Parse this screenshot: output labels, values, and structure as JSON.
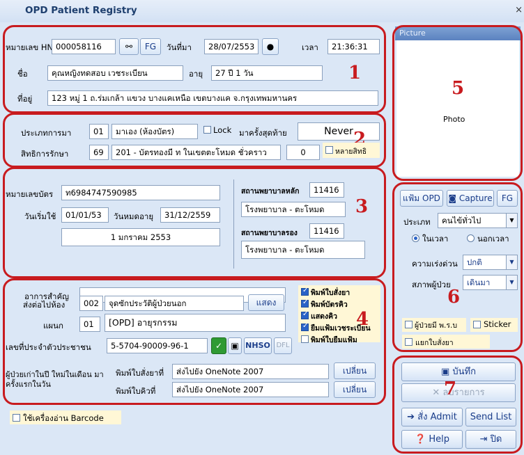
{
  "window": {
    "title": "OPD Patient Registry",
    "close": "×"
  },
  "sec1": {
    "hn_label": "หมายเลข HN",
    "hn_value": "000058116",
    "fg_label": "FG",
    "date_label": "วันที่มา",
    "date_value": "28/07/2553",
    "time_label": "เวลา",
    "time_value": "21:36:31",
    "name_label": "ชื่อ",
    "name_value": "คุณหญิงทดสอบ เวชระเบียน",
    "age_label": "อายุ",
    "age_value": "27 ปี 1 วัน",
    "address_label": "ที่อยู่",
    "address_value": "123 หมู่ 1 ถ.ร่มเกล้า แขวง บางแคเหนือ เขตบางแค จ.กรุงเทพมหานคร",
    "marker": "1"
  },
  "sec2": {
    "visit_type_label": "ประเภทการมา",
    "visit_type_code": "01",
    "visit_type_value": "มาเอง (ห้องบัตร)",
    "lock_label": "Lock",
    "last_visit_label": "มาครั้งสุดท้าย",
    "last_visit_value": "Never",
    "rights_label": "สิทธิการรักษา",
    "rights_code": "69",
    "rights_value": "201 - บัตรทองมี ท ในเขตตะโหมด ชั่วคราว",
    "rights_count": "0",
    "multi_rights_label": "หลายสิทธิ",
    "marker": "2"
  },
  "sec3": {
    "card_no_label": "หมายเลขบัตร",
    "card_no_value": "ท6984747590985",
    "start_label": "วันเริ่มใช้",
    "start_value": "01/01/53",
    "expire_label": "วันหมดอายุ",
    "expire_value": "31/12/2559",
    "date_text": "1 มกราคม 2553",
    "main_hosp_label": "สถานพยาบาลหลัก",
    "main_hosp_code": "11416",
    "main_hosp_name": "โรงพยาบาล - ตะโหมด",
    "sub_hosp_label": "สถานพยาบาลรอง",
    "sub_hosp_code": "11416",
    "sub_hosp_name": "โรงพยาบาล - ตะโหมด",
    "marker": "3"
  },
  "sec4": {
    "symptom_label": "อาการสำคัญ",
    "symptom_value": "",
    "room_label": "ส่งต่อไปห้อง",
    "room_code": "002",
    "room_value": "จุดซักประวัติผู้ป่วยนอก",
    "show_button": "แสดง",
    "dept_label": "แผนก",
    "dept_code": "01",
    "dept_value": "[OPD] อายุรกรรม",
    "cid_label": "เลขที่ประจำตัวประชาชน",
    "cid_value": "5-5704-90009-96-1",
    "nhso_label": "NHSO",
    "dfl_label": "DFL",
    "old_patient_text": "ผู้ป่วยเก่าในปี ใหม่ในเดือน มาครั้งแรกในวัน",
    "print_drug_label": "พิมพ์ใบสั่งยาที่",
    "print_drug_value": "ส่งไปยัง OneNote 2007",
    "print_queue_label": "พิมพ์ใบคิวที่",
    "print_queue_value": "ส่งไปยัง OneNote 2007",
    "change_label": "เปลี่ยน",
    "options": [
      {
        "label": "พิมพ์ใบสั่งยา",
        "checked": true
      },
      {
        "label": "พิมพ์บัตรคิว",
        "checked": true
      },
      {
        "label": "แสดงคิว",
        "checked": true
      },
      {
        "label": "ยืมแฟ้มเวชระเบียน",
        "checked": true
      },
      {
        "label": "พิมพ์ใบยืมแฟ้ม",
        "checked": false
      }
    ],
    "marker": "4"
  },
  "barcode_label": "ใช้เครื่องอ่าน Barcode",
  "sec5": {
    "picture_label": "Picture",
    "photo_text": "Photo",
    "marker": "5"
  },
  "sec6": {
    "opd_button": "แฟ้ม OPD",
    "capture_button": "Capture",
    "fg_button": "FG",
    "type_label": "ประเภท",
    "type_value": "คนไข้ทั่วไป",
    "in_time": "ในเวลา",
    "out_time": "นอกเวลา",
    "urgency_label": "ความเร่งด่วน",
    "urgency_value": "ปกติ",
    "condition_label": "สภาพผู้ป่วย",
    "condition_value": "เดินมา",
    "pcb_label": "ผู้ป่วยมี พ.ร.บ",
    "sticker_label": "Sticker",
    "split_label": "แยกใบสั่งยา",
    "marker": "6"
  },
  "sec7": {
    "save_button": "บันทึก",
    "delete_button": "ลบรายการ",
    "admit_button": "สั่ง Admit",
    "sendlist_button": "Send List",
    "help_button": "Help",
    "close_button": "ปิด",
    "marker": "7"
  }
}
